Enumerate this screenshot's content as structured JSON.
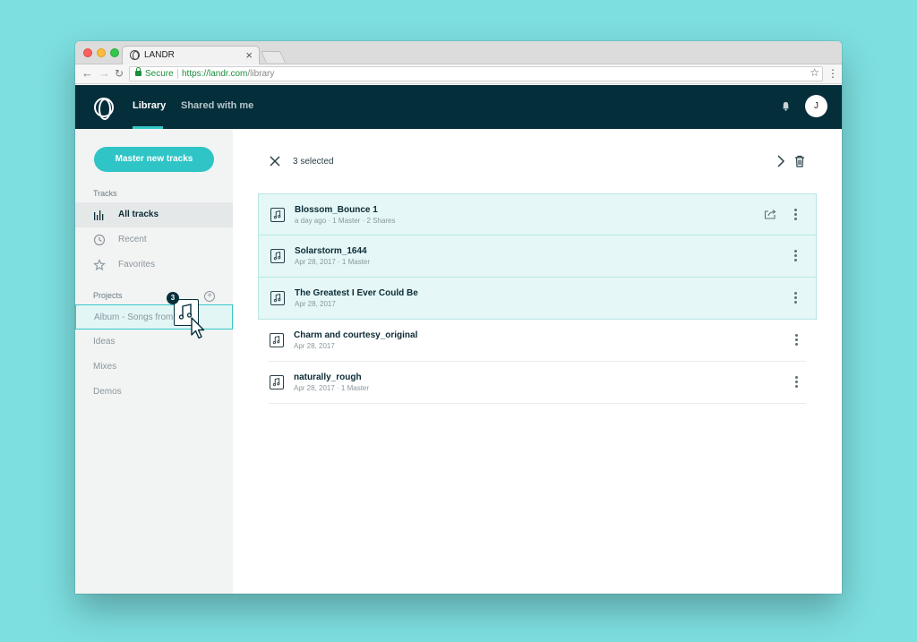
{
  "browser": {
    "tab_title": "LANDR",
    "tab_close": "×",
    "secure_label": "Secure",
    "url_host": "https://landr.com",
    "url_path": "/library"
  },
  "header": {
    "nav": [
      {
        "label": "Library",
        "active": true
      },
      {
        "label": "Shared with me",
        "active": false
      }
    ],
    "avatar_initial": "J"
  },
  "sidebar": {
    "master_button": "Master new tracks",
    "tracks_heading": "Tracks",
    "track_items": [
      {
        "label": "All tracks",
        "icon": "bars-icon",
        "active": true
      },
      {
        "label": "Recent",
        "icon": "clock-icon",
        "active": false
      },
      {
        "label": "Favorites",
        "icon": "star-icon",
        "active": false
      }
    ],
    "projects_heading": "Projects",
    "project_add": "+",
    "projects": [
      {
        "label": "Album - Songs from...",
        "drop_target": true
      },
      {
        "label": "Ideas"
      },
      {
        "label": "Mixes"
      },
      {
        "label": "Demos"
      }
    ]
  },
  "drag": {
    "count": "3"
  },
  "main": {
    "selected_label": "3 selected",
    "tracks": [
      {
        "name": "Blossom_Bounce 1",
        "meta": "a day ago · 1 Master · 2 Shares",
        "selected": true,
        "shareable": true
      },
      {
        "name": "Solarstorm_1644",
        "meta": "Apr 28, 2017 · 1 Master",
        "selected": true
      },
      {
        "name": "The Greatest I Ever Could Be",
        "meta": "Apr 28, 2017",
        "selected": true
      },
      {
        "name": "Charm and courtesy_original",
        "meta": "Apr 28, 2017",
        "selected": false
      },
      {
        "name": "naturally_rough",
        "meta": "Apr 28, 2017 · 1 Master",
        "selected": false
      }
    ]
  },
  "colors": {
    "accent": "#2fc5c6",
    "header_bg": "#052e3b",
    "page_bg": "#7ddfe0"
  }
}
